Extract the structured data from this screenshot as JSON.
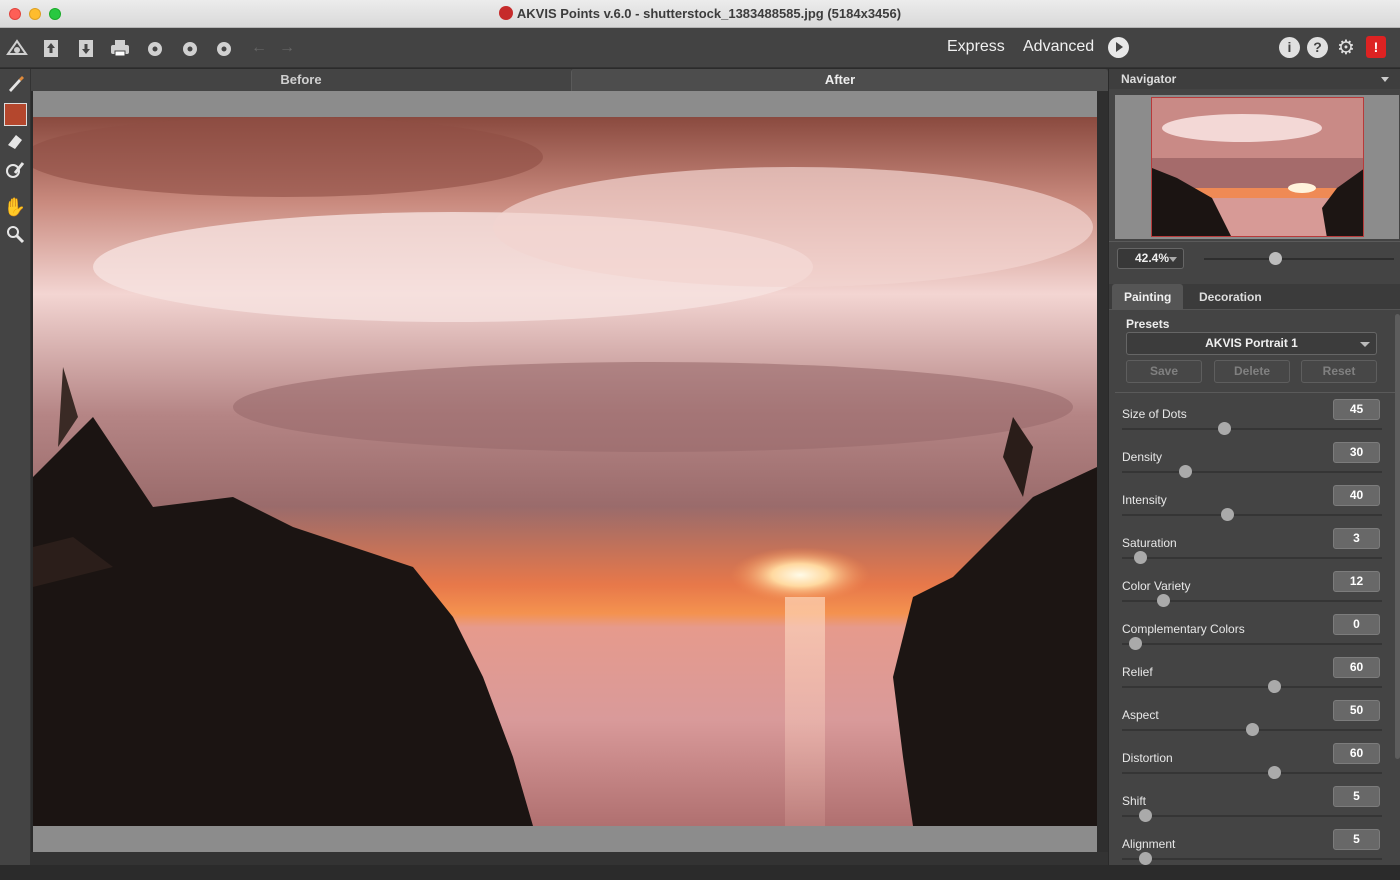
{
  "window": {
    "title": "AKVIS Points v.6.0 - shutterstock_1383488585.jpg (5184x3456)"
  },
  "toolbar": {
    "icons": [
      "home-icon",
      "open-icon",
      "save-icon",
      "print-icon",
      "share-icon",
      "plugin-icon",
      "settings-icon",
      "undo-icon",
      "redo-icon"
    ],
    "express_label": "Express",
    "advanced_label": "Advanced"
  },
  "tools": [
    "brush-icon",
    "color-swatch",
    "eraser-icon",
    "history-brush-icon",
    "hand-icon",
    "zoom-icon"
  ],
  "swatch_color": "#b4472d",
  "view_tabs": {
    "before": "Before",
    "after": "After",
    "active": "After"
  },
  "navigator": {
    "title": "Navigator",
    "zoom": "42.4%",
    "zoom_level": 0.37
  },
  "panel_tabs": {
    "painting": "Painting",
    "decoration": "Decoration",
    "active": "Painting"
  },
  "presets": {
    "label": "Presets",
    "selected": "AKVIS Portrait 1",
    "save": "Save",
    "delete": "Delete",
    "reset": "Reset"
  },
  "params": [
    {
      "label": "Size of Dots",
      "value": "45",
      "level": 0.39
    },
    {
      "label": "Density",
      "value": "30",
      "level": 0.23
    },
    {
      "label": "Intensity",
      "value": "40",
      "level": 0.4
    },
    {
      "label": "Saturation",
      "value": "3",
      "level": 0.05
    },
    {
      "label": "Color Variety",
      "value": "12",
      "level": 0.14
    },
    {
      "label": "Complementary Colors",
      "value": "0",
      "level": 0.03
    },
    {
      "label": "Relief",
      "value": "60",
      "level": 0.59
    },
    {
      "label": "Aspect",
      "value": "50",
      "level": 0.5
    },
    {
      "label": "Distortion",
      "value": "60",
      "level": 0.59
    },
    {
      "label": "Shift",
      "value": "5",
      "level": 0.07
    },
    {
      "label": "Alignment",
      "value": "5",
      "level": 0.07
    }
  ]
}
